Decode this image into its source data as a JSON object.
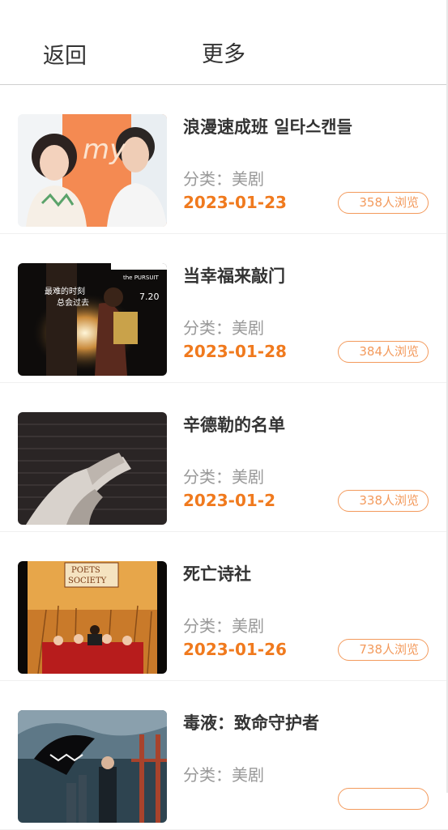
{
  "header": {
    "back_label": "返回",
    "more_label": "更多"
  },
  "items": [
    {
      "title": "浪漫速成班 일타스캔들",
      "category": "分类：美剧",
      "date": "2023-01-23",
      "views": "358人浏览",
      "poster": "romance-poster"
    },
    {
      "title": "当幸福来敲门",
      "category": "分类：美剧",
      "date": "2023-01-28",
      "views": "384人浏览",
      "poster": "pursuit-poster"
    },
    {
      "title": "辛德勒的名单",
      "category": "分类：美剧",
      "date": "2023-01-2",
      "views": "338人浏览",
      "poster": "schindler-poster"
    },
    {
      "title": "死亡诗社",
      "category": "分类：美剧",
      "date": "2023-01-26",
      "views": "738人浏览",
      "poster": "poets-poster"
    },
    {
      "title": "毒液：致命守护者",
      "category": "分类：美剧",
      "date": "",
      "views": "",
      "poster": "venom-poster"
    }
  ],
  "colors": {
    "accent": "#f07a1e",
    "badge_border": "#f39a5c",
    "title_text": "#333333",
    "muted_text": "#999999"
  }
}
